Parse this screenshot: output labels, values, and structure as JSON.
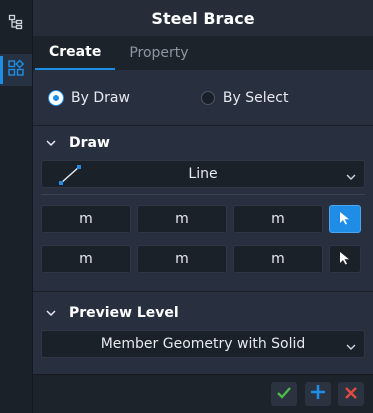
{
  "title": "Steel Brace",
  "sidebar": {
    "icons": [
      "tree-icon",
      "components-icon"
    ]
  },
  "tabs": [
    {
      "label": "Create"
    },
    {
      "label": "Property"
    }
  ],
  "mode": {
    "options": [
      {
        "label": "By Draw",
        "selected": true
      },
      {
        "label": "By Select",
        "selected": false
      }
    ]
  },
  "draw": {
    "header": "Draw",
    "shape": {
      "value": "Line",
      "icon": "line-icon"
    },
    "start_point": {
      "x": "m",
      "y": "m",
      "z": "m"
    },
    "end_point": {
      "x": "m",
      "y": "m",
      "z": "m"
    }
  },
  "preview": {
    "header": "Preview Level",
    "value": "Member Geometry with Solid"
  },
  "footer": {
    "buttons": [
      "confirm-icon",
      "add-icon",
      "close-icon"
    ]
  },
  "colors": {
    "accent": "#1f8de6",
    "confirm": "#4fb84a",
    "close": "#e04a3f"
  }
}
